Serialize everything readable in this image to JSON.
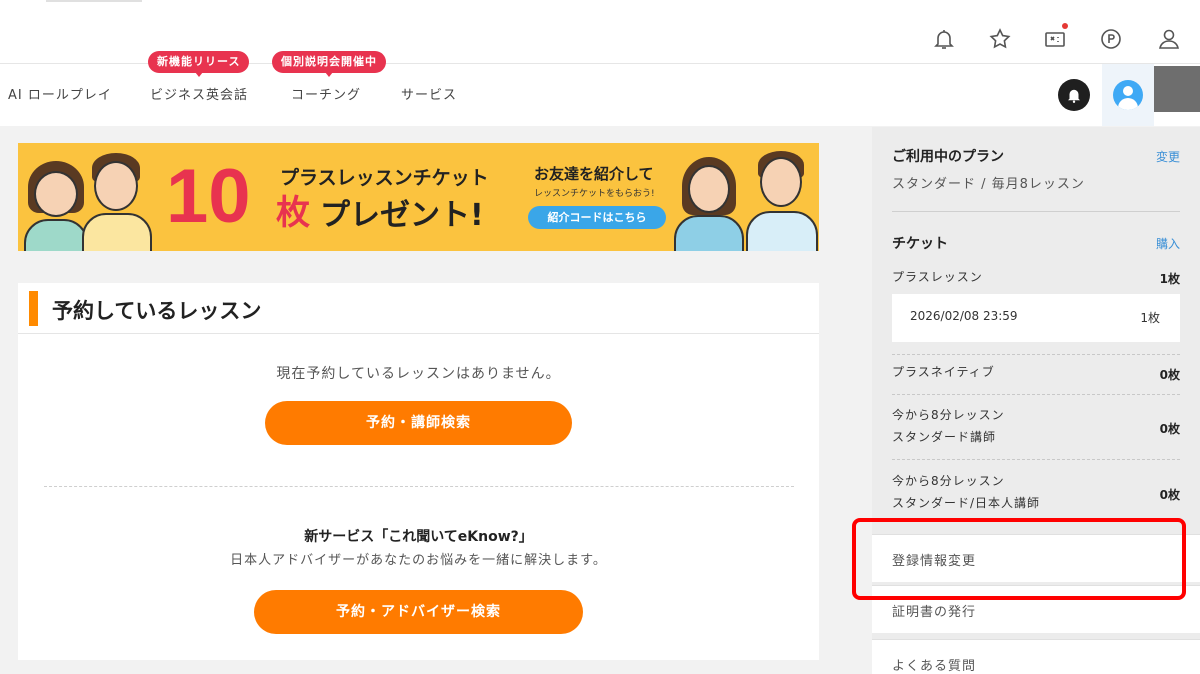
{
  "nav": {
    "items": [
      {
        "label": "AI ロールプレイ"
      },
      {
        "label": "ビジネス英会話",
        "badge": "新機能リリース"
      },
      {
        "label": "コーチング",
        "badge": "個別説明会開催中"
      },
      {
        "label": "サービス"
      }
    ]
  },
  "header_icons": [
    "bell-icon",
    "star-icon",
    "coupon-icon",
    "points-icon",
    "user-icon"
  ],
  "banner": {
    "big_number": "10",
    "title": "プラスレッスンチケット",
    "mai": "枚",
    "present": "プレゼント!",
    "friend": "お友達を紹介して",
    "sub": "レッスンチケットをもらおう!",
    "button": "紹介コードはこちら"
  },
  "lessons": {
    "title": "予約しているレッスン",
    "empty_message": "現在予約しているレッスンはありません。",
    "search_button": "予約・講師検索",
    "service_title": "新サービス「これ聞いてeKnow?」",
    "service_desc": "日本人アドバイザーがあなたのお悩みを一緒に解決します。",
    "advisor_button": "予約・アドバイザー検索"
  },
  "sidebar": {
    "plan_title": "ご利用中のプラン",
    "plan_change": "変更",
    "plan_name": "スタンダード / 毎月8レッスン",
    "ticket_title": "チケット",
    "ticket_buy": "購入",
    "plus_lesson_label": "プラスレッスン",
    "plus_lesson_value": "1枚",
    "ticket_date": "2026/02/08 23:59",
    "ticket_count": "1枚",
    "plus_native_label": "プラスネイティブ",
    "plus_native_value": "0枚",
    "std_line1": "今から8分レッスン",
    "std_line2": "スタンダード講師",
    "std_value": "0枚",
    "jp_line1": "今から8分レッスン",
    "jp_line2": "スタンダード/日本人講師",
    "jp_value": "0枚",
    "menu_register": "登録情報変更",
    "menu_certificate": "証明書の発行",
    "menu_faq": "よくある質問"
  },
  "colors": {
    "accent_orange": "#ff7b00",
    "badge_red": "#e8334f",
    "link_blue": "#3a8fd6",
    "banner_yellow": "#fbc33f",
    "highlight_red": "#ff0000"
  }
}
